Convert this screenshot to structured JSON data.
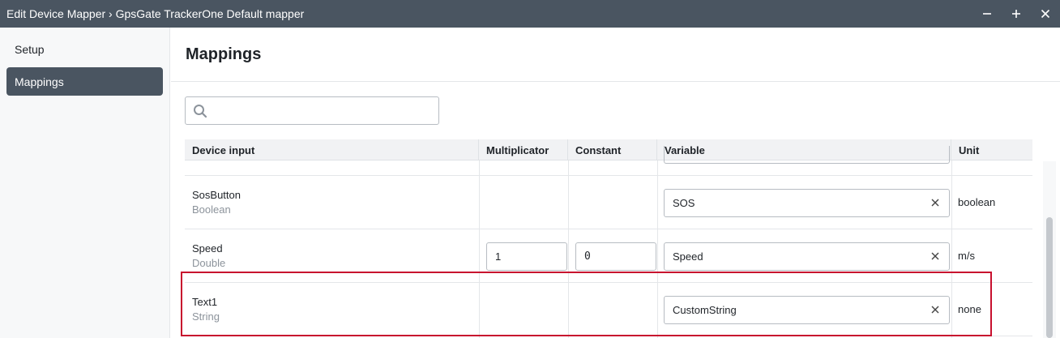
{
  "window": {
    "title": "Edit Device Mapper › GpsGate TrackerOne Default mapper",
    "controls": [
      "minimize-icon",
      "maximize-icon",
      "close-icon"
    ]
  },
  "sidebar": {
    "items": [
      {
        "label": "Setup",
        "active": false
      },
      {
        "label": "Mappings",
        "active": true
      }
    ]
  },
  "main": {
    "title": "Mappings",
    "search": {
      "value": "",
      "placeholder": "",
      "icon": "search-icon"
    }
  },
  "table": {
    "columns": [
      "Device input",
      "Multiplicator",
      "Constant",
      "Variable",
      "Unit"
    ],
    "rows": [
      {
        "name": "SosButton",
        "type": "Boolean",
        "multiplicator": "",
        "constant": "",
        "variable": "SOS",
        "unit": "boolean"
      },
      {
        "name": "Speed",
        "type": "Double",
        "multiplicator": "1",
        "constant": "0",
        "variable": "Speed",
        "unit": "m/s"
      },
      {
        "name": "Text1",
        "type": "String",
        "multiplicator": "",
        "constant": "",
        "variable": "CustomString",
        "unit": "none"
      }
    ]
  },
  "colors": {
    "titlebar": "#4a5561",
    "active_nav": "#4a5561",
    "highlight": "#c8102e"
  }
}
